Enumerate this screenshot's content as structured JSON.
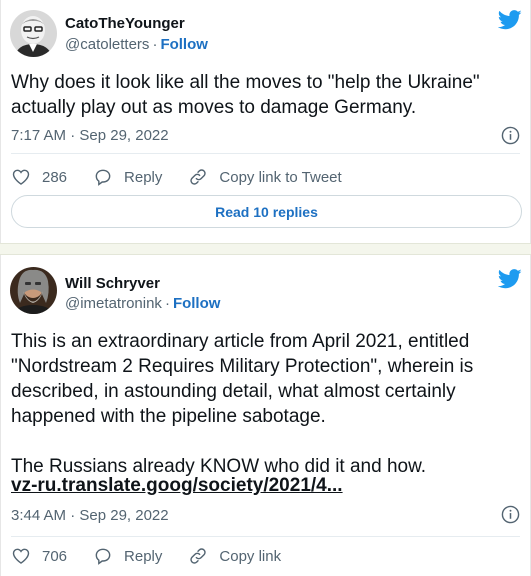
{
  "tweets": [
    {
      "author_name": "CatoTheYounger",
      "handle": "@catoletters",
      "separator": "·",
      "follow_label": "Follow",
      "text": "Why does it look like all the moves to \"help the Ukraine\"\nactually play out as moves to damage Germany.",
      "timestamp": "7:17 AM · Sep 29, 2022",
      "like_count": "286",
      "reply_label": "Reply",
      "copy_label": "Copy link to Tweet",
      "read_replies_label": "Read 10 replies"
    },
    {
      "author_name": "Will Schryver",
      "handle": "@imetatronink",
      "separator": "·",
      "follow_label": "Follow",
      "text": "This is an extraordinary article from April 2021, entitled\n\"Nordstream 2 Requires Military Protection\", wherein is\ndescribed, in astounding detail, what almost certainly\nhappened with the pipeline sabotage.\n\nThe Russians already KNOW who did it and how.",
      "link_text": "vz-ru.translate.goog/society/2021/4...",
      "timestamp": "3:44 AM · Sep 29, 2022",
      "like_count": "706",
      "reply_label": "Reply",
      "copy_label": "Copy link"
    }
  ],
  "icons": {
    "brand": "twitter-bird-icon",
    "like": "heart-icon",
    "reply": "reply-bubble-icon",
    "copy": "link-icon",
    "info": "info-icon"
  },
  "colors": {
    "twitter_blue": "#1d9bf0",
    "link_blue": "#1d70c2",
    "secondary_text": "#536471",
    "primary_text": "#0f1419"
  }
}
